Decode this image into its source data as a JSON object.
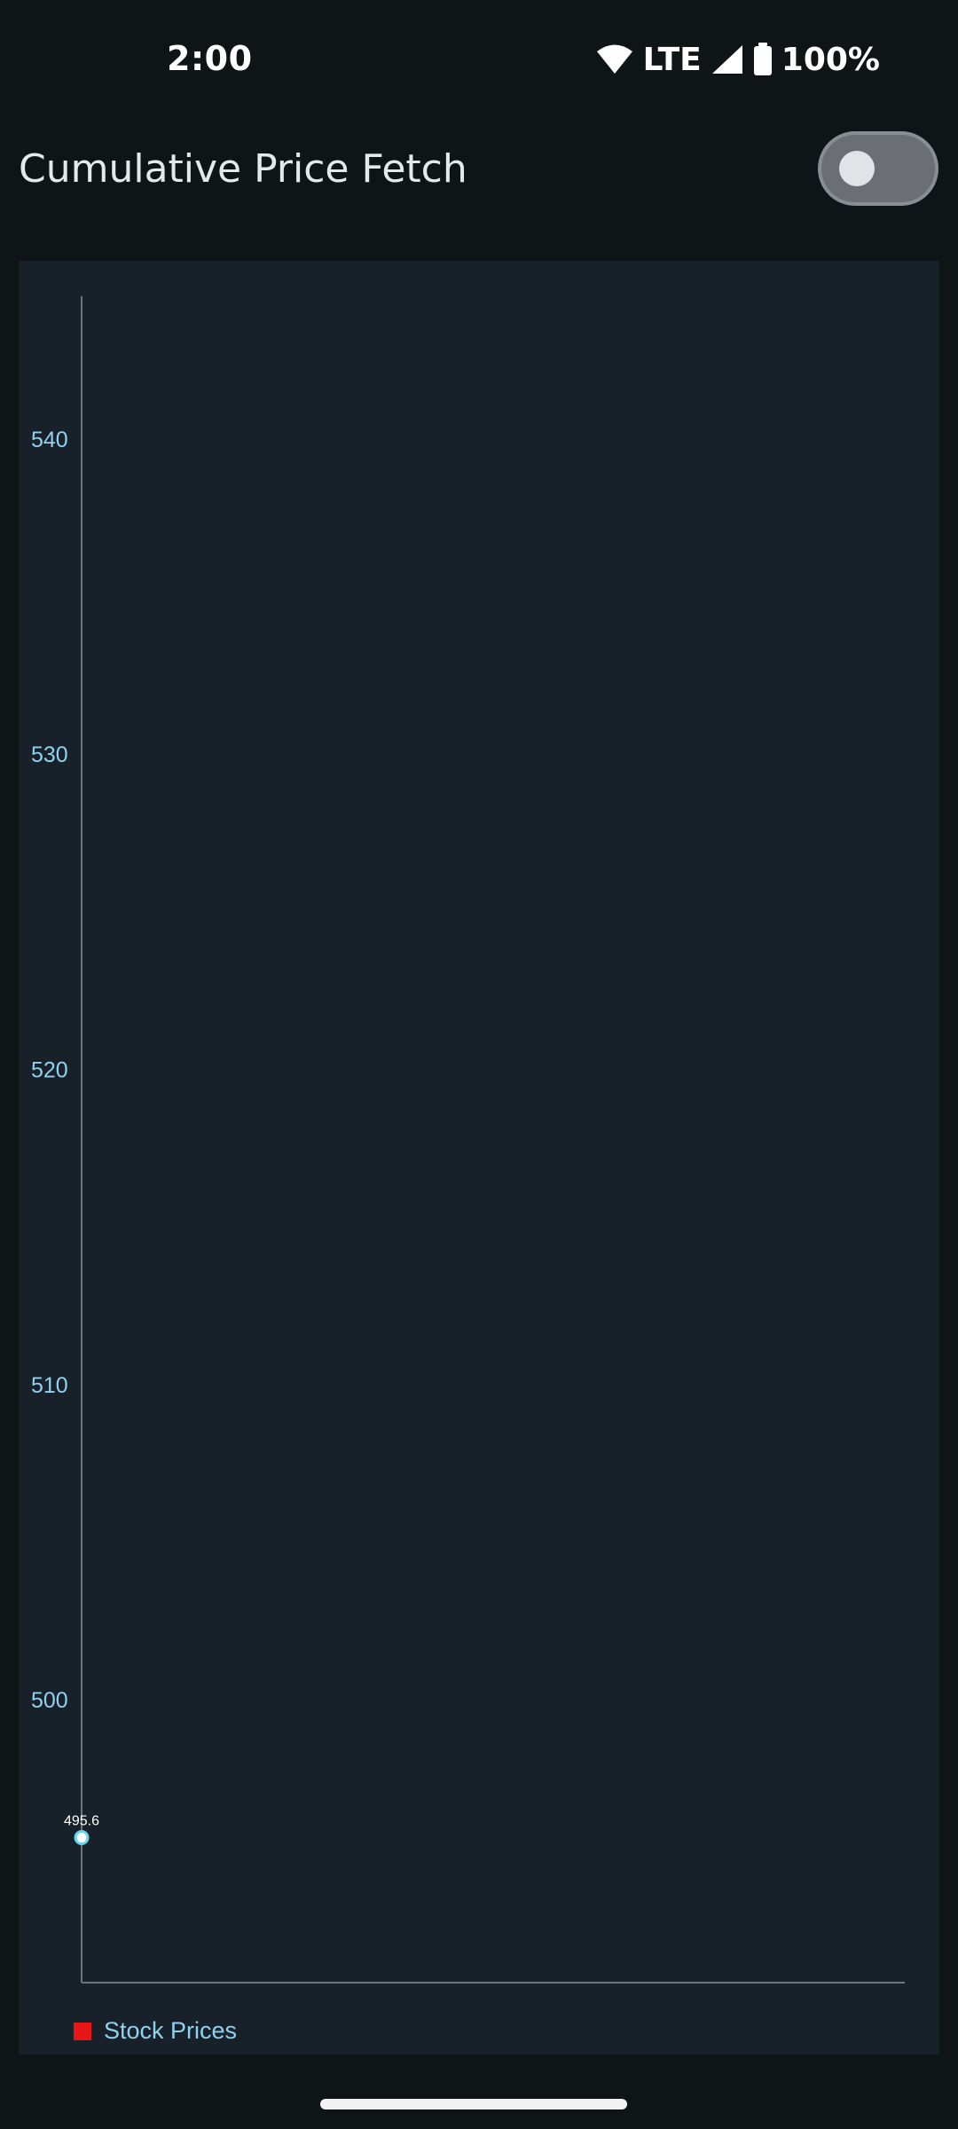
{
  "status_bar": {
    "time": "2:00",
    "network": "LTE",
    "battery": "100%",
    "icons": [
      "wifi-icon",
      "signal-icon",
      "battery-icon"
    ]
  },
  "header": {
    "title": "Cumulative Price Fetch",
    "toggle_state": "off"
  },
  "colors": {
    "background": "#0f1417",
    "panel": "#18202a",
    "axis_text": "#8fd2ee",
    "legend_swatch": "#e81616",
    "point": "#ffffff"
  },
  "chart_data": {
    "type": "line",
    "title": "",
    "xlabel": "",
    "ylabel": "",
    "ylim": [
      491,
      544.5
    ],
    "yticks": [
      500,
      510,
      520,
      530,
      540
    ],
    "series": [
      {
        "name": "Stock Prices",
        "points": [
          {
            "x": 0,
            "y": 495.6,
            "label": "495.6"
          }
        ]
      }
    ],
    "legend": "bottom-left",
    "grid": false
  }
}
